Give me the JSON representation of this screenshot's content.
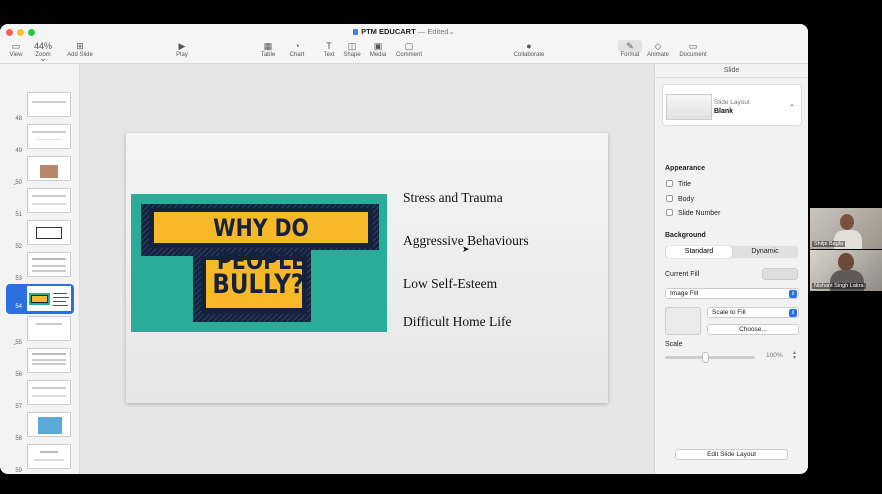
{
  "window": {
    "title": "PTM EDUCART",
    "status": " — Edited",
    "title_chevron": "⌄"
  },
  "toolbar": {
    "items": [
      {
        "label": "View",
        "icon": "sidebar-icon",
        "glyph": "▭"
      },
      {
        "label": "Zoom",
        "icon": "zoom-icon",
        "glyph": "44% ⌄"
      },
      {
        "label": "Add Slide",
        "icon": "add-slide-icon",
        "glyph": "⊞"
      },
      {
        "label": "Play",
        "icon": "play-icon",
        "glyph": "▶"
      },
      {
        "label": "Table",
        "icon": "table-icon",
        "glyph": "▦"
      },
      {
        "label": "Chart",
        "icon": "chart-icon",
        "glyph": "◔"
      },
      {
        "label": "Text",
        "icon": "text-icon",
        "glyph": "T"
      },
      {
        "label": "Shape",
        "icon": "shape-icon",
        "glyph": "◫"
      },
      {
        "label": "Media",
        "icon": "media-icon",
        "glyph": "▣"
      },
      {
        "label": "Comment",
        "icon": "comment-icon",
        "glyph": "▢"
      },
      {
        "label": "Collaborate",
        "icon": "collaborate-icon",
        "glyph": "●"
      },
      {
        "label": "Format",
        "icon": "format-icon",
        "glyph": "✎"
      },
      {
        "label": "Animate",
        "icon": "animate-icon",
        "glyph": "◇"
      },
      {
        "label": "Document",
        "icon": "document-icon",
        "glyph": "▭"
      }
    ]
  },
  "navigator": {
    "slides": [
      "48",
      "49",
      "50",
      "51",
      "52",
      "53",
      "54",
      "55",
      "56",
      "57",
      "58",
      "59",
      "60"
    ],
    "selected": "54"
  },
  "slide": {
    "graphic_line1": "WHY DO PEOPLE",
    "graphic_line2": "BULLY?",
    "bullets": [
      "Stress and Trauma",
      "Aggressive Behaviours",
      "Low Self-Esteem",
      "Difficult Home Life"
    ]
  },
  "inspector": {
    "header": "Slide",
    "layout_label": "Slide Layout",
    "layout_value": "Blank",
    "appearance_title": "Appearance",
    "appearance_options": [
      "Title",
      "Body",
      "Slide Number"
    ],
    "background_title": "Background",
    "tabs": [
      "Standard",
      "Dynamic"
    ],
    "current_fill_label": "Current Fill",
    "fill_type": "Image Fill",
    "scale_mode": "Scale to Fill",
    "choose_button": "Choose...",
    "scale_label": "Scale",
    "scale_value": "100%",
    "edit_layout_button": "Edit Slide Layout"
  },
  "participants": [
    {
      "name": "Shilpi Bagla"
    },
    {
      "name": "Nishant Singh Lakra"
    }
  ],
  "colors": {
    "accent": "#2b6fe0",
    "teal": "#2aad98",
    "yellow": "#f7b928",
    "navy": "#16213b"
  }
}
